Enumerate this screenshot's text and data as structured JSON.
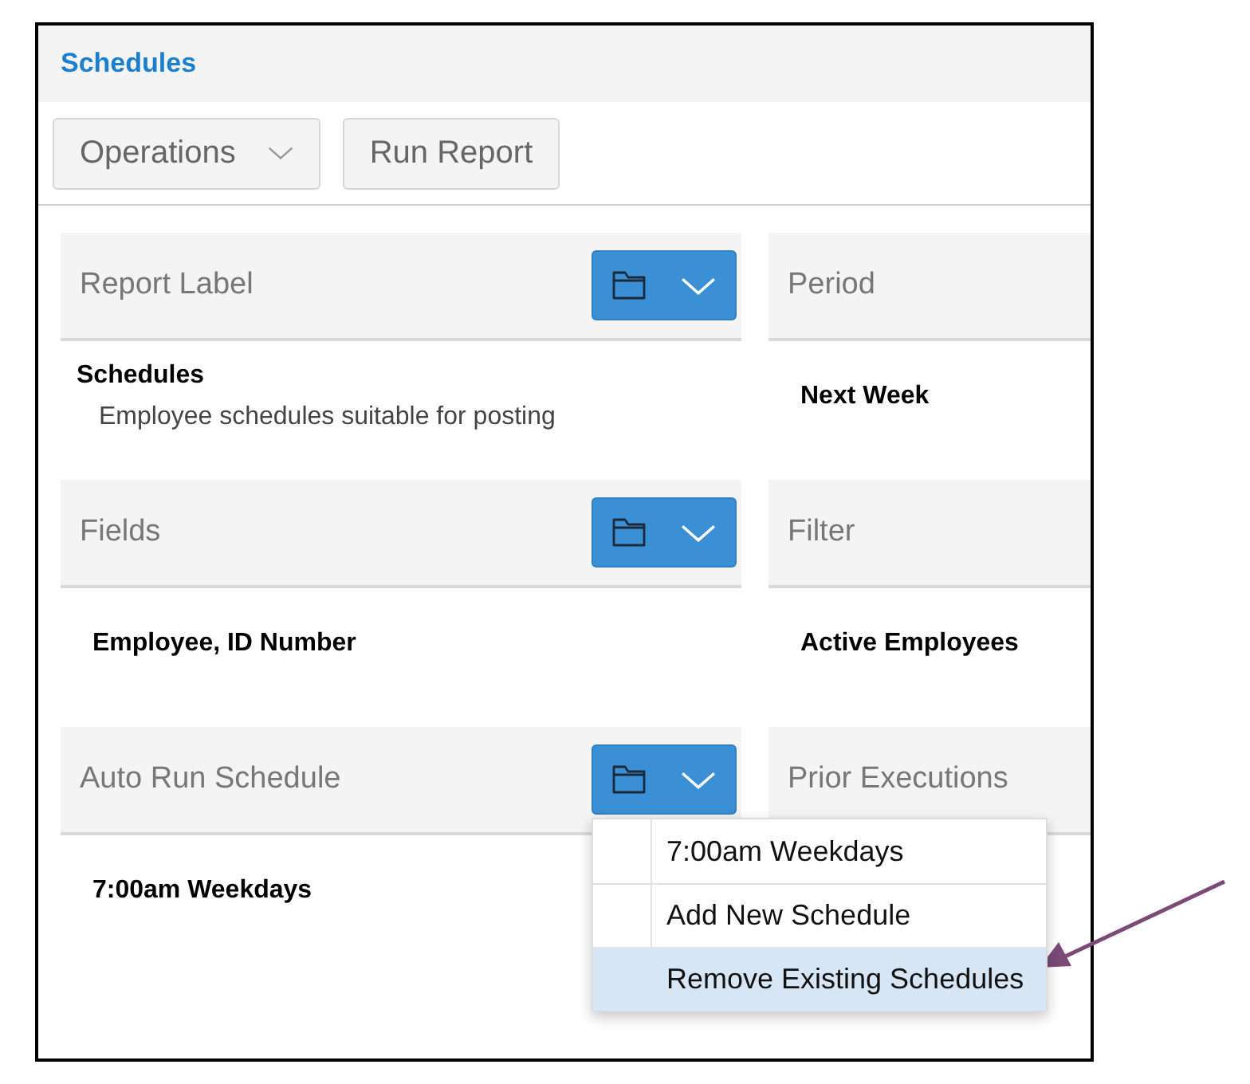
{
  "header": {
    "title": "Schedules"
  },
  "toolbar": [
    {
      "label": "Operations",
      "kind": "dropdown"
    },
    {
      "label": "Run Report",
      "kind": "plain"
    }
  ],
  "panels": [
    {
      "title": "Report Label",
      "menu_button": true,
      "value": "Schedules",
      "description": "Employee schedules suitable for posting"
    },
    {
      "title": "Period",
      "menu_button": false,
      "value": "Next Week"
    },
    {
      "title": "Fields",
      "menu_button": true,
      "value": "Employee, ID Number"
    },
    {
      "title": "Filter",
      "menu_button": false,
      "value": "Active Employees"
    },
    {
      "title": "Auto Run Schedule",
      "menu_button": true,
      "value": "7:00am Weekdays",
      "menu": {
        "items": [
          {
            "label": "7:00am Weekdays",
            "selected": false
          },
          {
            "label": "Add New Schedule",
            "selected": false
          },
          {
            "label": "Remove Existing Schedules",
            "selected": true
          }
        ]
      }
    },
    {
      "title": "Prior Executions",
      "menu_button": false
    }
  ]
}
